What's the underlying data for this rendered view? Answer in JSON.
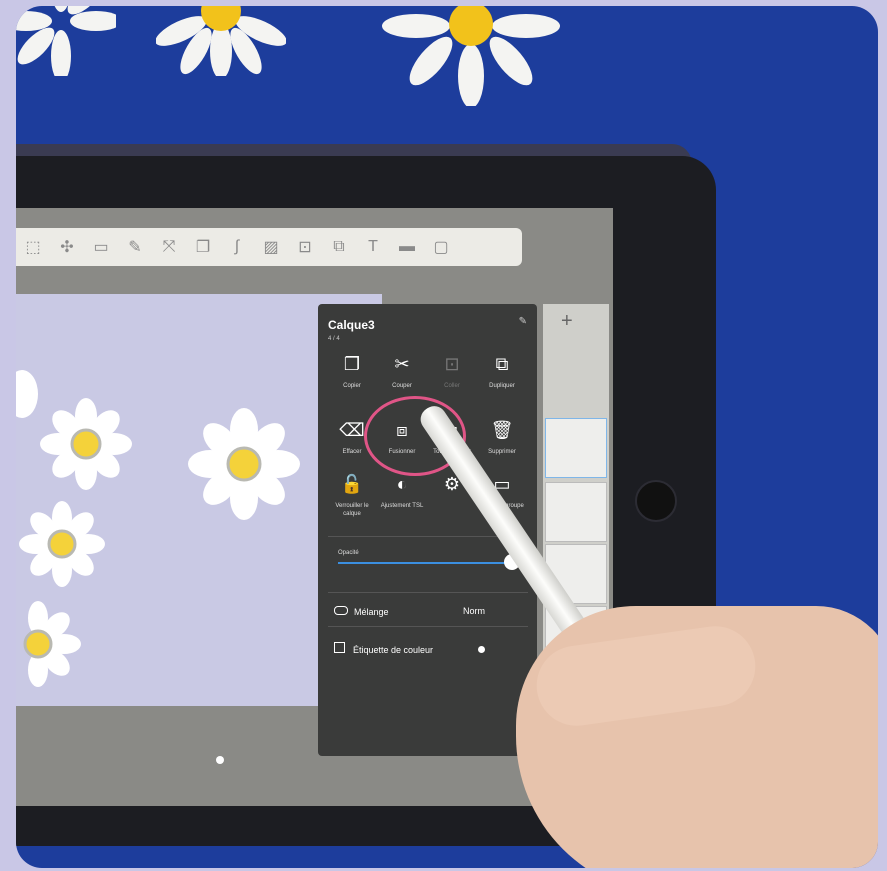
{
  "image": {
    "kind": "photograph",
    "subject": "hand holding stylus tapping a layer options menu on an iPad drawing app",
    "colors": {
      "background_board": "#1d3d9c",
      "frame": "#c9c7e6",
      "highlight_circle": "#e05587",
      "canvas": "#c9c9e4"
    }
  },
  "app": {
    "toolbar_icons": [
      "select-icon",
      "move-icon",
      "document-icon",
      "pencil-icon",
      "transform-icon",
      "layers-copy-icon",
      "curve-icon",
      "image-icon",
      "paste-icon",
      "text-frame-icon",
      "text-icon",
      "color-icon",
      "frame-icon"
    ],
    "add_layer_label": "+"
  },
  "layer_menu": {
    "title": "Calque3",
    "count": "4 / 4",
    "actions": [
      {
        "label": "Copier",
        "icon": "copy-icon",
        "dim": false
      },
      {
        "label": "Couper",
        "icon": "scissors-icon",
        "dim": false
      },
      {
        "label": "Coller",
        "icon": "paste-icon",
        "dim": true
      },
      {
        "label": "Dupliquer",
        "icon": "duplicate-icon",
        "dim": false
      },
      {
        "label": "Effacer",
        "icon": "clear-icon",
        "dim": false
      },
      {
        "label": "Fusionner",
        "icon": "merge-icon",
        "dim": false
      },
      {
        "label": "Tout fusionner",
        "icon": "merge-all-icon",
        "dim": false
      },
      {
        "label": "Supprimer",
        "icon": "trash-icon",
        "dim": false
      },
      {
        "label": "Verrouiller le calque",
        "icon": "lock-icon",
        "dim": false
      },
      {
        "label": "Ajustement TSL",
        "icon": "adjust-icon",
        "dim": false
      },
      {
        "label": "",
        "icon": "settings-icon",
        "dim": false
      },
      {
        "label": "Créer un groupe",
        "icon": "folder-icon",
        "dim": false
      }
    ],
    "opacity_label": "Opacité",
    "opacity_value": "100",
    "blend_label": "Mélange",
    "blend_value": "Norm",
    "color_tag_label": "Étiquette de couleur"
  }
}
